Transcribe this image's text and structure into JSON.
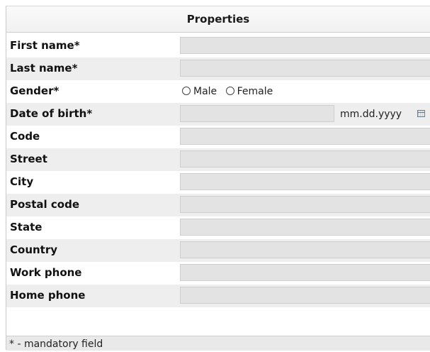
{
  "panel": {
    "title": "Properties"
  },
  "fields": {
    "first_name": {
      "label": "First name*",
      "value": ""
    },
    "last_name": {
      "label": "Last name*",
      "value": ""
    },
    "gender": {
      "label": "Gender*",
      "options": [
        "Male",
        "Female"
      ],
      "selected": null
    },
    "date_of_birth": {
      "label": "Date of birth*",
      "value": "",
      "format": "mm.dd.yyyy"
    },
    "code": {
      "label": "Code",
      "value": ""
    },
    "street": {
      "label": "Street",
      "value": ""
    },
    "city": {
      "label": "City",
      "value": ""
    },
    "postal_code": {
      "label": "Postal code",
      "value": ""
    },
    "state": {
      "label": "State",
      "value": ""
    },
    "country": {
      "label": "Country",
      "value": ""
    },
    "work_phone": {
      "label": "Work phone",
      "value": ""
    },
    "home_phone": {
      "label": "Home phone",
      "value": ""
    }
  },
  "footer": {
    "note": "* - mandatory field"
  },
  "icons": {
    "date_picker": "calendar-icon",
    "radio": "radio-circle-icon"
  }
}
